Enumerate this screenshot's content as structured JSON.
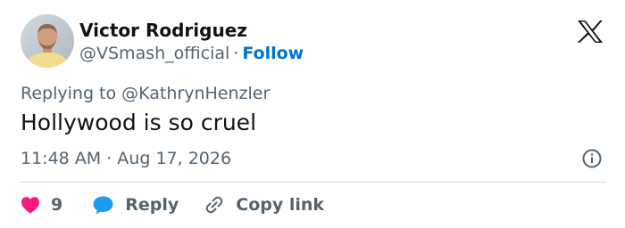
{
  "author": {
    "display_name": "Victor Rodriguez",
    "handle": "@VSmash_official",
    "separator": "·",
    "follow_label": "Follow"
  },
  "tweet": {
    "replying_to": "Replying to @KathrynHenzler",
    "text": "Hollywood is so cruel",
    "timestamp": "11:48 AM · Aug 17, 2026"
  },
  "actions": {
    "like_count": "9",
    "reply_label": "Reply",
    "copy_link_label": "Copy link"
  },
  "icons": {
    "brand": "x-logo-icon",
    "info": "info-icon",
    "like": "heart-icon",
    "reply": "speech-bubble-icon",
    "copy": "link-icon"
  },
  "colors": {
    "text_primary": "#0f1419",
    "text_secondary": "#536471",
    "follow_link": "#0074cc",
    "heart": "#f91880",
    "reply_bubble": "#1d9bf0",
    "divider": "#cfd9de"
  }
}
